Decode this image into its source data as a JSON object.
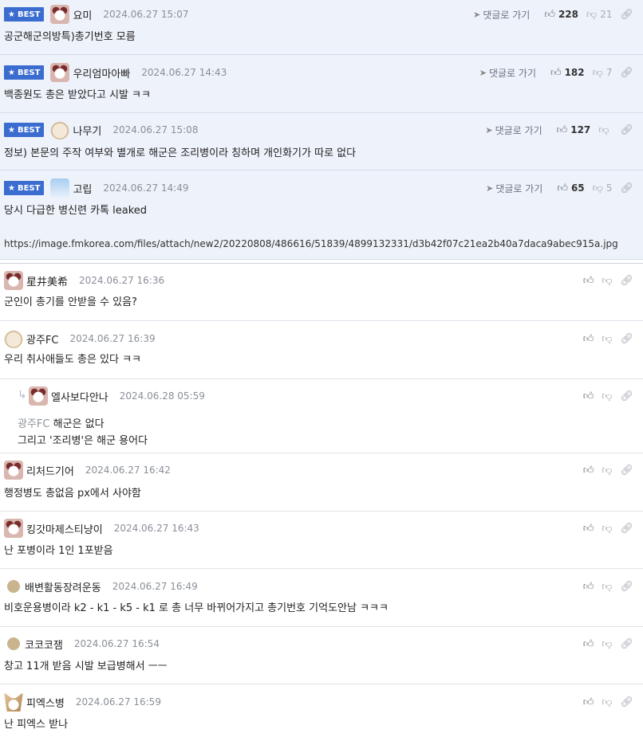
{
  "best_label": "BEST",
  "goto_label": "댓글로 가기",
  "comments": [
    {
      "nick": "요미",
      "date": "2024.06.27 15:07",
      "up": "228",
      "down": "21",
      "text": "공군해군의방특)총기번호 모름"
    },
    {
      "nick": "우리엄마아빠",
      "date": "2024.06.27 14:43",
      "up": "182",
      "down": "7",
      "text": "백종원도 총은 받았다고 시발 ㅋㅋ"
    },
    {
      "nick": "나무기",
      "date": "2024.06.27 15:08",
      "up": "127",
      "down": "",
      "text": "정보) 본문의 주작 여부와 별개로 해군은 조리병이라 칭하며 개인화기가 따로 없다"
    },
    {
      "nick": "고립",
      "date": "2024.06.27 14:49",
      "up": "65",
      "down": "5",
      "text": "당시 다급한 병신련 카톡 leaked",
      "url": "https://image.fmkorea.com/files/attach/new2/20220808/486616/51839/4899132331/d3b42f07c21ea2b40a7daca9abec915a.jpg"
    },
    {
      "nick": "星井美希",
      "date": "2024.06.27 16:36",
      "text": "군인이 총기를 안받을 수 있음?"
    },
    {
      "nick": "광주FC",
      "date": "2024.06.27 16:39",
      "text": "우리 취사애들도 총은 있다 ㅋㅋ"
    },
    {
      "nick": "엘사보다안나",
      "date": "2024.06.28 05:59",
      "ref": "광주FC",
      "text": "해군은 없다",
      "text2": "그리고 '조리병'은 해군 용어다"
    },
    {
      "nick": "리처드기어",
      "date": "2024.06.27 16:42",
      "text": "행정병도 총없음 px에서 사야함"
    },
    {
      "nick": "킹갓마제스티냥이",
      "date": "2024.06.27 16:43",
      "text": "난 포병이라 1인 1포받음"
    },
    {
      "nick": "배변활동장려운동",
      "date": "2024.06.27 16:49",
      "text": "비호운용병이라 k2 - k1 - k5 - k1 로 총 너무 바뀌어가지고 총기번호 기억도안남 ㅋㅋㅋ"
    },
    {
      "nick": "코코코잼",
      "date": "2024.06.27 16:54",
      "text": "창고 11개 받음 시발 보급병해서 ㅡㅡ"
    },
    {
      "nick": "피엑스병",
      "date": "2024.06.27 16:59",
      "text": "난 피엑스 받나"
    }
  ]
}
